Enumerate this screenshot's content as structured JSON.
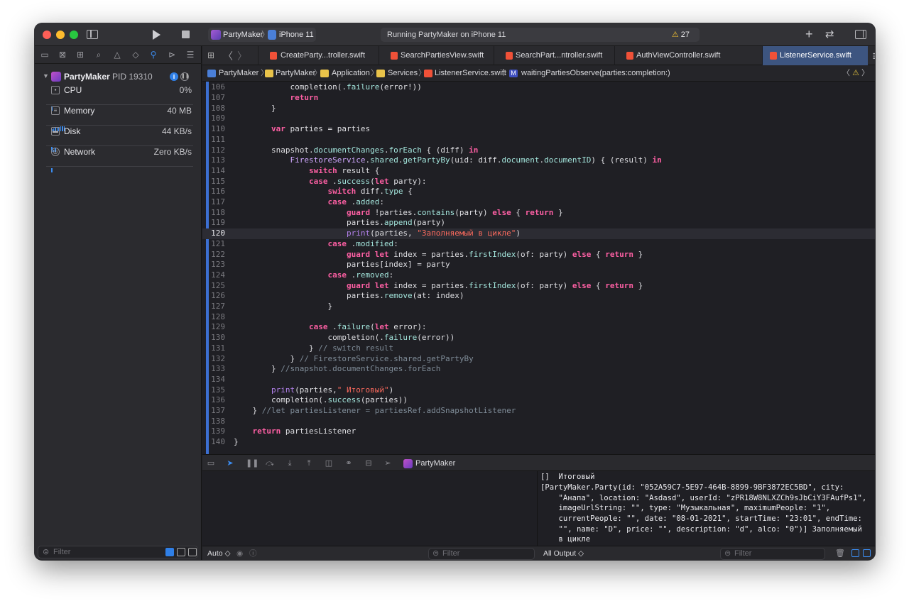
{
  "colors": {
    "accent": "#3b8cf0",
    "keyword": "#fc5fa3",
    "string": "#fc6a5d",
    "comment": "#7f8c98",
    "active_tab": "#3d5580",
    "warning": "#f4c230"
  },
  "toolbar": {
    "scheme": "PartyMaker",
    "device": "iPhone 11",
    "activity": "Running PartyMaker on iPhone 11",
    "warning_count": "27",
    "warning_icon": "⚠"
  },
  "navigator": {
    "process": {
      "name": "PartyMaker",
      "pid": "PID 19310"
    },
    "gauges": [
      {
        "name": "CPU",
        "value": "0%",
        "icon": "cpu-icon"
      },
      {
        "name": "Memory",
        "value": "40 MB",
        "icon": "memory-icon"
      },
      {
        "name": "Disk",
        "value": "44 KB/s",
        "icon": "disk-icon"
      },
      {
        "name": "Network",
        "value": "Zero KB/s",
        "icon": "network-icon"
      }
    ],
    "filter_placeholder": "Filter"
  },
  "tabs": [
    {
      "label": "CreateParty...troller.swift",
      "active": false
    },
    {
      "label": "SearchPartiesView.swift",
      "active": false
    },
    {
      "label": "SearchPart...ntroller.swift",
      "active": false
    },
    {
      "label": "AuthViewController.swift",
      "active": false
    },
    {
      "label": "ListenerService.swift",
      "active": true
    }
  ],
  "jumpbar": {
    "project": "PartyMaker",
    "group1": "PartyMaker",
    "group2": "Application",
    "group3": "Services",
    "file": "ListenerService.swift",
    "method": "waitingPartiesObserve(parties:completion:)"
  },
  "code": {
    "current_line": "120",
    "lines": [
      {
        "n": "106",
        "t": "            completion(.failure(error!))"
      },
      {
        "n": "107",
        "t": "            return"
      },
      {
        "n": "108",
        "t": "        }"
      },
      {
        "n": "109",
        "t": ""
      },
      {
        "n": "110",
        "t": "        var parties = parties"
      },
      {
        "n": "111",
        "t": ""
      },
      {
        "n": "112",
        "t": "        snapshot.documentChanges.forEach { (diff) in"
      },
      {
        "n": "113",
        "t": "            FirestoreService.shared.getPartyBy(uid: diff.document.documentID) { (result) in"
      },
      {
        "n": "114",
        "t": "                switch result {"
      },
      {
        "n": "115",
        "t": "                case .success(let party):"
      },
      {
        "n": "116",
        "t": "                    switch diff.type {"
      },
      {
        "n": "117",
        "t": "                    case .added:"
      },
      {
        "n": "118",
        "t": "                        guard !parties.contains(party) else { return }"
      },
      {
        "n": "119",
        "t": "                        parties.append(party)"
      },
      {
        "n": "120",
        "t": "                        print(parties, \"Заполняемый в цикле\")"
      },
      {
        "n": "121",
        "t": "                    case .modified:"
      },
      {
        "n": "122",
        "t": "                        guard let index = parties.firstIndex(of: party) else { return }"
      },
      {
        "n": "123",
        "t": "                        parties[index] = party"
      },
      {
        "n": "124",
        "t": "                    case .removed:"
      },
      {
        "n": "125",
        "t": "                        guard let index = parties.firstIndex(of: party) else { return }"
      },
      {
        "n": "126",
        "t": "                        parties.remove(at: index)"
      },
      {
        "n": "127",
        "t": "                    }"
      },
      {
        "n": "128",
        "t": ""
      },
      {
        "n": "129",
        "t": "                case .failure(let error):"
      },
      {
        "n": "130",
        "t": "                    completion(.failure(error))"
      },
      {
        "n": "131",
        "t": "                } // switch result"
      },
      {
        "n": "132",
        "t": "            } // FirestoreService.shared.getPartyBy"
      },
      {
        "n": "133",
        "t": "        } //snapshot.documentChanges.forEach"
      },
      {
        "n": "134",
        "t": ""
      },
      {
        "n": "135",
        "t": "        print(parties,\" Итоговый\")"
      },
      {
        "n": "136",
        "t": "        completion(.success(parties))"
      },
      {
        "n": "137",
        "t": "    } //let partiesListener = partiesRef.addSnapshotListener"
      },
      {
        "n": "138",
        "t": ""
      },
      {
        "n": "139",
        "t": "    return partiesListener"
      },
      {
        "n": "140",
        "t": "}"
      }
    ]
  },
  "debug": {
    "target": "PartyMaker"
  },
  "console": {
    "lines": [
      "[]  Итоговый",
      "[PartyMaker.Party(id: \"052A59C7-5E97-464B-8899-9BF3872EC5BD\", city:",
      "    \"Анапа\", location: \"Asdasd\", userId: \"zPR18W8NLXZCh9sJbCiY3FAufPs1\",",
      "    imageUrlString: \"\", type: \"Музыкальная\", maximumPeople: \"1\",",
      "    currentPeople: \"\", date: \"08-01-2021\", startTime: \"23:01\", endTime:",
      "    \"\", name: \"D\", price: \"\", description: \"d\", alco: \"0\")] Заполняемый",
      "    в цикле"
    ]
  },
  "bottom": {
    "auto_label": "Auto ◇",
    "vars_filter": "Filter",
    "output_label": "All Output ◇",
    "console_filter": "Filter"
  }
}
